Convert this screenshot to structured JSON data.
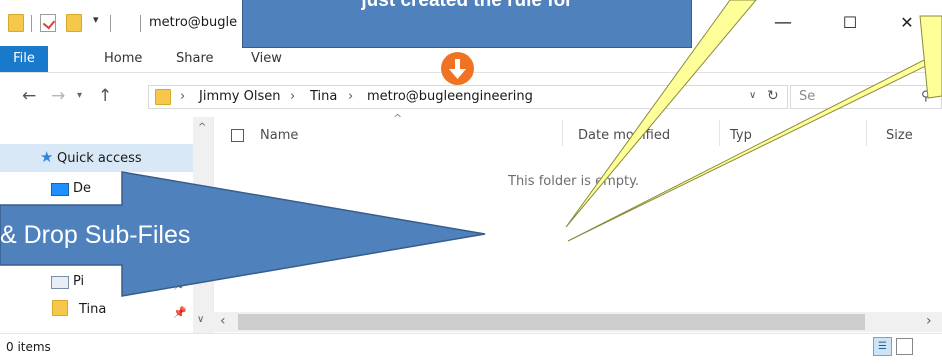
{
  "window": {
    "title": "metro@bugle",
    "minimize": "—",
    "maximize": "☐",
    "close": "✕"
  },
  "ribbon": {
    "tabs": [
      "File",
      "Home",
      "Share",
      "View"
    ]
  },
  "address": {
    "crumbs": [
      "Jimmy Olsen",
      "Tina",
      "metro@bugleengineering"
    ],
    "search_placeholder": "Se"
  },
  "nav_pane": {
    "items": [
      {
        "label": "Quick access"
      },
      {
        "label": "De"
      },
      {
        "label": "Pi"
      },
      {
        "label": "Tina"
      }
    ]
  },
  "columns": [
    "Name",
    "Date modified",
    "Typ",
    "Size"
  ],
  "content": {
    "empty_message": "This folder is empty."
  },
  "status": {
    "item_count": "0 items"
  },
  "annotations": {
    "top_callout": "just created the rule for",
    "arrow_label": "& Drop Sub-Files"
  },
  "colors": {
    "accent": "#1979ca",
    "callout_fill": "#4f81bd",
    "speech_yellow": "#ffff99",
    "badge_orange": "#ef7322"
  }
}
